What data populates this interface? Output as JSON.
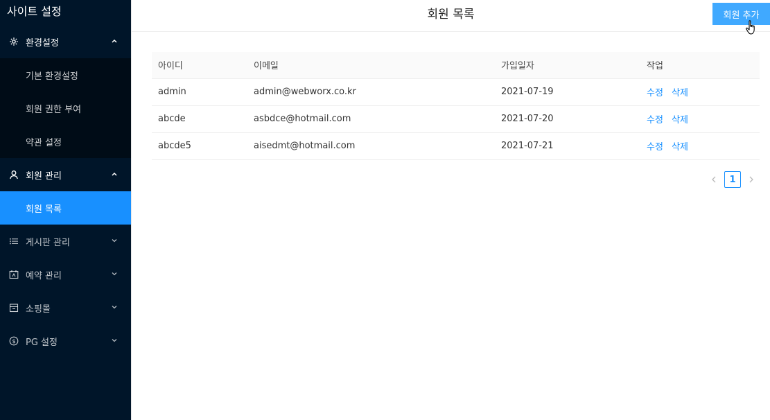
{
  "sidebar": {
    "brand": "사이트 설정",
    "groups": [
      {
        "label": "환경설정",
        "icon": "gear-icon",
        "expanded": true,
        "items": [
          {
            "label": "기본 환경설정"
          },
          {
            "label": "회원 권한 부여"
          },
          {
            "label": "약관 설정"
          }
        ]
      },
      {
        "label": "회원 관리",
        "icon": "user-icon",
        "expanded": true,
        "items": [
          {
            "label": "회원 목록",
            "active": true
          }
        ]
      },
      {
        "label": "게시판 관리",
        "icon": "list-icon",
        "expanded": false
      },
      {
        "label": "예약 관리",
        "icon": "calendar-icon",
        "expanded": false
      },
      {
        "label": "소핑몰",
        "icon": "shop-icon",
        "expanded": false
      },
      {
        "label": "PG 설정",
        "icon": "dollar-icon",
        "expanded": false
      }
    ]
  },
  "header": {
    "title": "회원 목록",
    "add_button": "회원 추가"
  },
  "table": {
    "columns": [
      "아이디",
      "이메일",
      "가입일자",
      "작업"
    ],
    "rows": [
      {
        "id": "admin",
        "email": "admin@webworx.co.kr",
        "date": "2021-07-19"
      },
      {
        "id": "abcde",
        "email": "asbdce@hotmail.com",
        "date": "2021-07-20"
      },
      {
        "id": "abcde5",
        "email": "aisedmt@hotmail.com",
        "date": "2021-07-21"
      }
    ],
    "edit_label": "수정",
    "delete_label": "삭제"
  },
  "pagination": {
    "current": "1"
  },
  "colors": {
    "sidebar_bg": "#001529",
    "submenu_bg": "#000c17",
    "accent": "#1890ff",
    "button": "#40a9ff"
  }
}
